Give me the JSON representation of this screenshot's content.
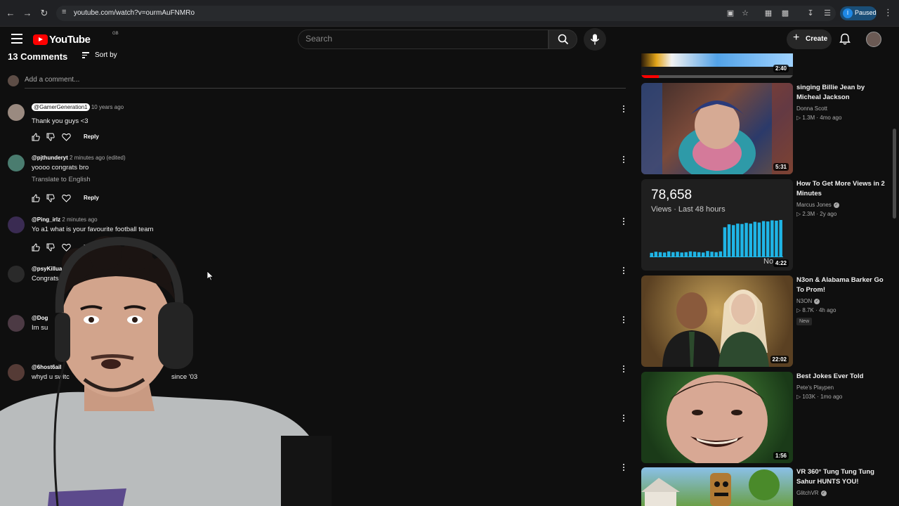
{
  "browser": {
    "url": "youtube.com/watch?v=ourmAuFNMRo",
    "profile_initial": "I",
    "profile_status": "Paused"
  },
  "masthead": {
    "logo_text": "YouTube",
    "country_code": "GB",
    "search_placeholder": "Search",
    "create_label": "Create"
  },
  "comments": {
    "count_label": "13 Comments",
    "sort_label": "Sort by",
    "add_placeholder": "Add a comment...",
    "items": [
      {
        "handle": "@GamerGeneration1",
        "time": "10 years ago",
        "text": "Thank you guys <3",
        "reply": "Reply"
      },
      {
        "handle": "@pjthunderyt",
        "time": "2 minutes ago (edited)",
        "text": "yoooo congrats bro",
        "translate": "Translate to English",
        "reply": "Reply"
      },
      {
        "handle": "@Ping_irlz",
        "time": "2 minutes ago",
        "text": "Yo a1 what is your favourite football team",
        "reply": "Repl"
      },
      {
        "handle": "@psyKillua",
        "time": "7",
        "text": "Congrats"
      },
      {
        "handle": "@Dog",
        "text": "Im su"
      },
      {
        "handle": "@6host6ail",
        "text": "whyd u switc",
        "text_tail": "since '03"
      },
      {
        "handle": "@",
        "text_tail": "mate"
      }
    ]
  },
  "sidebar": {
    "items": [
      {
        "duration": "2:40"
      },
      {
        "title": "singing Billie Jean by Micheal Jackson",
        "channel": "Donna Scott",
        "views": "1.3M",
        "age": "4mo ago",
        "duration": "5:31"
      },
      {
        "title": "How To Get More Views in 2 Minutes",
        "channel": "Marcus Jones",
        "views": "2.3M",
        "age": "2y ago",
        "duration": "4:22",
        "overlay_count": "78,658",
        "overlay_caption": "Views · Last 48 hours",
        "overlay_tail": "No"
      },
      {
        "title": "N3on & Alabama Barker Go To Prom!",
        "channel": "N3ON",
        "views": "8.7K",
        "age": "4h ago",
        "badge": "New",
        "duration": "22:02"
      },
      {
        "title": "Best Jokes Ever Told",
        "channel": "Pete's Playpen",
        "views": "103K",
        "age": "1mo ago",
        "duration": "1:56"
      },
      {
        "title": "VR 360° Tung Tung Tung Sahur HUNTS YOU!",
        "channel": "GlitchVR"
      }
    ]
  },
  "colors": {
    "accent_red": "#ff0000",
    "chart_cyan": "#1fb5e6",
    "background": "#0f0f0f"
  }
}
